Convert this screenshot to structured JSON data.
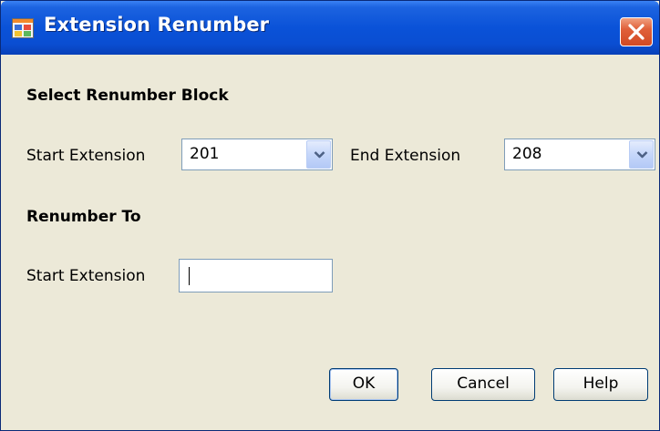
{
  "window": {
    "title": "Extension Renumber",
    "icon": "app-window-icon",
    "close_icon": "close-icon"
  },
  "block_section": {
    "heading": "Select Renumber Block",
    "start_label": "Start Extension",
    "start_value": "201",
    "end_label": "End Extension",
    "end_value": "208"
  },
  "renumber_section": {
    "heading": "Renumber To",
    "start_label": "Start Extension",
    "start_value": ""
  },
  "buttons": {
    "ok": "OK",
    "cancel": "Cancel",
    "help": "Help"
  },
  "colors": {
    "titlebar": "#0a52d8",
    "dialog_bg": "#ece9d8",
    "close_button": "#d24a24",
    "input_border": "#7f9db9"
  }
}
